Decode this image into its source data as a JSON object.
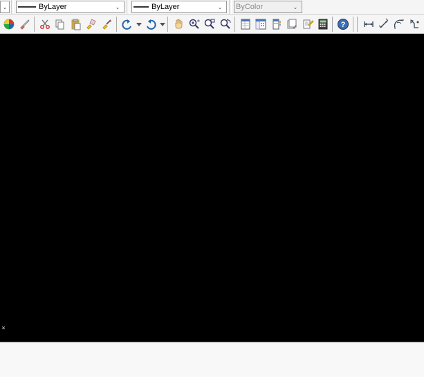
{
  "row1": {
    "dd1_width": 157,
    "dd1_swatch_w": 26,
    "dd1_swatch_h": 2,
    "dd1_label": "ByLayer",
    "dd2_width": 138,
    "dd2_swatch_w": 22,
    "dd2_swatch_h": 1,
    "dd2_label": "ByLayer",
    "dd3_width": 99,
    "dd3_label": "ByColor"
  },
  "toolbar": {
    "icons": [
      "color-wheel",
      "brush",
      "sep",
      "cut",
      "copy",
      "clipboard",
      "paint",
      "match-properties",
      "sep",
      "undo",
      "dd",
      "redo",
      "dd",
      "sep",
      "pan",
      "zoom-in",
      "zoom-window",
      "zoom-extents",
      "sep",
      "properties",
      "design-center",
      "tool-palettes",
      "sheet-set",
      "markup",
      "calculator",
      "sep",
      "help",
      "sep",
      "sep",
      "distance",
      "chain",
      "arc-length",
      "select-cursor"
    ]
  },
  "viewport": {
    "cursor_char": "×"
  },
  "commandbar": {
    "text": ""
  }
}
